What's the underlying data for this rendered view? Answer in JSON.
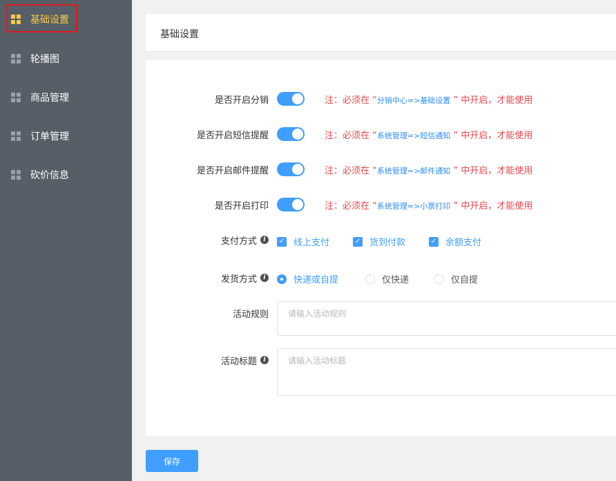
{
  "sidebar": {
    "items": [
      {
        "label": "基础设置",
        "icon": "grid-icon",
        "active": true
      },
      {
        "label": "轮播图",
        "icon": "grid-icon",
        "active": false
      },
      {
        "label": "商品管理",
        "icon": "grid-icon",
        "active": false
      },
      {
        "label": "订单管理",
        "icon": "grid-icon",
        "active": false
      },
      {
        "label": "砍价信息",
        "icon": "grid-icon",
        "active": false
      }
    ]
  },
  "header": {
    "title": "基础设置"
  },
  "form": {
    "toggles": [
      {
        "label": "是否开启分销",
        "enabled": true,
        "note_prefix": "注：必须在 “",
        "note_path": "分销中心=>基础设置",
        "note_suffix": "” 中开启，才能使用"
      },
      {
        "label": "是否开启短信提醒",
        "enabled": true,
        "note_prefix": "注：必须在 “",
        "note_path": "系统管理=>短信通知",
        "note_suffix": "” 中开启，才能使用"
      },
      {
        "label": "是否开启邮件提醒",
        "enabled": true,
        "note_prefix": "注：必须在 “",
        "note_path": "系统管理=>邮件通知",
        "note_suffix": "” 中开启，才能使用"
      },
      {
        "label": "是否开启打印",
        "enabled": true,
        "note_prefix": "注：必须在 “",
        "note_path": "系统管理=>小票打印",
        "note_suffix": "” 中开启，才能使用"
      }
    ],
    "payment": {
      "label": "支付方式",
      "options": [
        {
          "label": "线上支付",
          "checked": true
        },
        {
          "label": "货到付款",
          "checked": true
        },
        {
          "label": "余额支付",
          "checked": true
        }
      ]
    },
    "delivery": {
      "label": "发货方式",
      "options": [
        {
          "label": "快递或自提",
          "selected": true
        },
        {
          "label": "仅快递",
          "selected": false
        },
        {
          "label": "仅自提",
          "selected": false
        }
      ]
    },
    "rules": {
      "label": "活动规则",
      "placeholder": "请输入活动规则",
      "value": ""
    },
    "title": {
      "label": "活动标题",
      "placeholder": "请输入活动标题",
      "value": ""
    }
  },
  "actions": {
    "save_label": "保存"
  },
  "colors": {
    "sidebar_bg": "#565e67",
    "active": "#f7c948",
    "primary": "#409eff",
    "note": "#e5484d"
  }
}
